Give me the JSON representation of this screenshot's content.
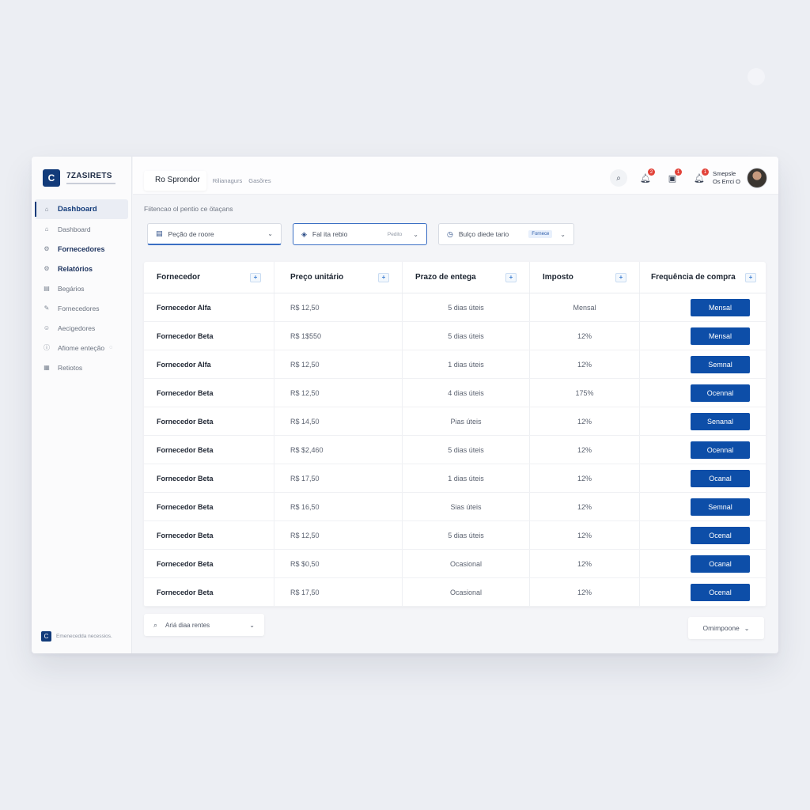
{
  "app": {
    "logo_mark": "C",
    "brand_name": "7ZASIRETS",
    "accent_color": "#0d4ea8",
    "brand_color": "#123b7a"
  },
  "sidebar": {
    "items": [
      {
        "label": "Dashboard",
        "icon": "home-icon",
        "glyph": "⌂",
        "active": true
      },
      {
        "label": "Dashboard",
        "icon": "home-icon",
        "glyph": "⌂"
      },
      {
        "label": "Fornecedores",
        "icon": "gear-icon",
        "glyph": "⚙",
        "bold": true
      },
      {
        "label": "Relatórios",
        "icon": "gear-icon",
        "glyph": "⚙",
        "bold": true
      },
      {
        "label": "Begários",
        "icon": "document-icon",
        "glyph": "▤"
      },
      {
        "label": "Fornecedores",
        "icon": "pencil-icon",
        "glyph": "✎"
      },
      {
        "label": "Aecigedores",
        "icon": "smile-icon",
        "glyph": "☺"
      },
      {
        "label": "Afiome enteção",
        "icon": "info-icon",
        "glyph": "ⓘ",
        "trail": "◌"
      },
      {
        "label": "Retiotos",
        "icon": "calendar-icon",
        "glyph": "▦"
      }
    ],
    "footer_mark": "C",
    "footer_text": "Emenecedda necessios."
  },
  "header": {
    "tabs": {
      "main": "Ro Sprondor",
      "second": "Rilianagurs",
      "third": "Gasõres"
    },
    "user": {
      "line1": "Smepsle",
      "line2": "Os Errci O"
    },
    "badges": [
      "2",
      "1",
      "1"
    ]
  },
  "filters": {
    "label": "Fiitencao ol pentio ce ötaçans",
    "f1": {
      "text": "Peção de roore",
      "icon": "document-icon"
    },
    "f2": {
      "text": "Fal ita rebio",
      "hint": "Pedito",
      "icon": "tag-icon"
    },
    "f3": {
      "text": "Bulço diede tario",
      "chip": "Fornece",
      "icon": "clock-icon"
    }
  },
  "table": {
    "headers": [
      "Fornecedor",
      "Preço unitário",
      "Prazo de entega",
      "Imposto",
      "Frequência de compra"
    ],
    "rows": [
      {
        "fornecedor": "Fornecedor Alfa",
        "preco": "R$ 12,50",
        "prazo": "5 dias úteis",
        "imposto": "Mensal",
        "freq": "Mensal"
      },
      {
        "fornecedor": "Fornecedor Beta",
        "preco": "R$ 1$550",
        "prazo": "5 dias úteis",
        "imposto": "12%",
        "freq": "Mensal"
      },
      {
        "fornecedor": "Fornecedor Alfa",
        "preco": "R$ 12,50",
        "prazo": "1 dias úteis",
        "imposto": "12%",
        "freq": "Semnal"
      },
      {
        "fornecedor": "Fornecedor Beta",
        "preco": "R$ 12,50",
        "prazo": "4 dias úteis",
        "imposto": "175%",
        "freq": "Ocennal"
      },
      {
        "fornecedor": "Fornecedor Beta",
        "preco": "R$ 14,50",
        "prazo": "Pias úteis",
        "imposto": "12%",
        "freq": "Senanal"
      },
      {
        "fornecedor": "Fornecedor Beta",
        "preco": "R$ $2,460",
        "prazo": "5 dias úteis",
        "imposto": "12%",
        "freq": "Ocennal"
      },
      {
        "fornecedor": "Fornecedor Beta",
        "preco": "R$ 17,50",
        "prazo": "1 dias úteis",
        "imposto": "12%",
        "freq": "Ocanal"
      },
      {
        "fornecedor": "Fornecedor Beta",
        "preco": "R$ 16,50",
        "prazo": "Sias úteis",
        "imposto": "12%",
        "freq": "Semnal"
      },
      {
        "fornecedor": "Fornecedor Beta",
        "preco": "R$ 12,50",
        "prazo": "5 dias úteis",
        "imposto": "12%",
        "freq": "Ocenal"
      },
      {
        "fornecedor": "Fornecedor Beta",
        "preco": "R$ $0,50",
        "prazo": "Ocasional",
        "imposto": "12%",
        "freq": "Ocanal"
      },
      {
        "fornecedor": "Fornecedor Beta",
        "preco": "R$ 17,50",
        "prazo": "Ocasional",
        "imposto": "12%",
        "freq": "Ocenal"
      }
    ]
  },
  "bottom": {
    "search_text": "Ariá diaa rentes",
    "select_text": "Omimpoone"
  }
}
